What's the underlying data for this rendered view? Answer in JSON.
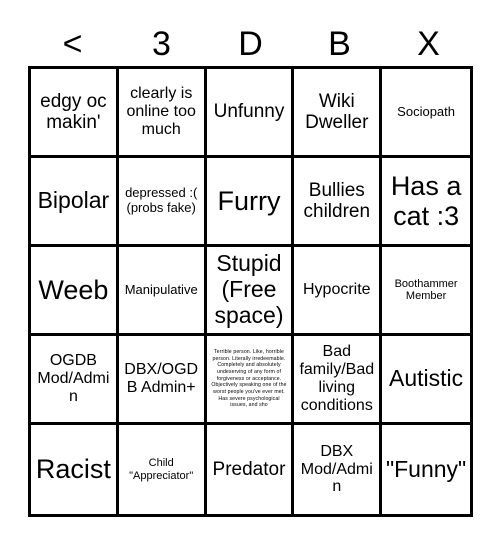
{
  "card": {
    "header_letters": [
      "<",
      "3",
      "D",
      "B",
      "X"
    ],
    "background_color": "#ffffff",
    "line_color": "#000000",
    "text_color": "#000000",
    "columns": 5,
    "rows": 5,
    "cells": [
      {
        "text": "edgy oc makin'",
        "size": "lg"
      },
      {
        "text": "clearly is online too much",
        "size": "md"
      },
      {
        "text": "Unfunny",
        "size": "lg"
      },
      {
        "text": "Wiki Dweller",
        "size": "lg"
      },
      {
        "text": "Sociopath",
        "size": "sm"
      },
      {
        "text": "Bipolar",
        "size": "xl"
      },
      {
        "text": "depressed :( (probs fake)",
        "size": "sm"
      },
      {
        "text": "Furry",
        "size": "xxl"
      },
      {
        "text": "Bullies children",
        "size": "lg"
      },
      {
        "text": "Has a cat :3",
        "size": "xxl"
      },
      {
        "text": "Weeb",
        "size": "xxl"
      },
      {
        "text": "Manipulative",
        "size": "sm"
      },
      {
        "text": "Stupid (Free space)",
        "size": "xl"
      },
      {
        "text": "Hypocrite",
        "size": "md"
      },
      {
        "text": "Boothammer Member",
        "size": "xs"
      },
      {
        "text": "OGDB Mod/Admin",
        "size": "md"
      },
      {
        "text": "DBX/OGDB Admin+",
        "size": "md"
      },
      {
        "text": "Terrible person. Like, horrible person. Literally irredeemable. Completely and absolutely undeserving of any form of forgiveness or acceptance. Objectively speaking one of the worst people you've ever met. Has severe psychological issues, and sho",
        "size": "tiny"
      },
      {
        "text": "Bad family/Bad living conditions",
        "size": "md"
      },
      {
        "text": "Autistic",
        "size": "xl"
      },
      {
        "text": "Racist",
        "size": "xxl"
      },
      {
        "text": "Child \"Appreciator\"",
        "size": "xs"
      },
      {
        "text": "Predator",
        "size": "lg"
      },
      {
        "text": "DBX Mod/Admin",
        "size": "md"
      },
      {
        "text": "\"Funny\"",
        "size": "xl"
      }
    ]
  }
}
